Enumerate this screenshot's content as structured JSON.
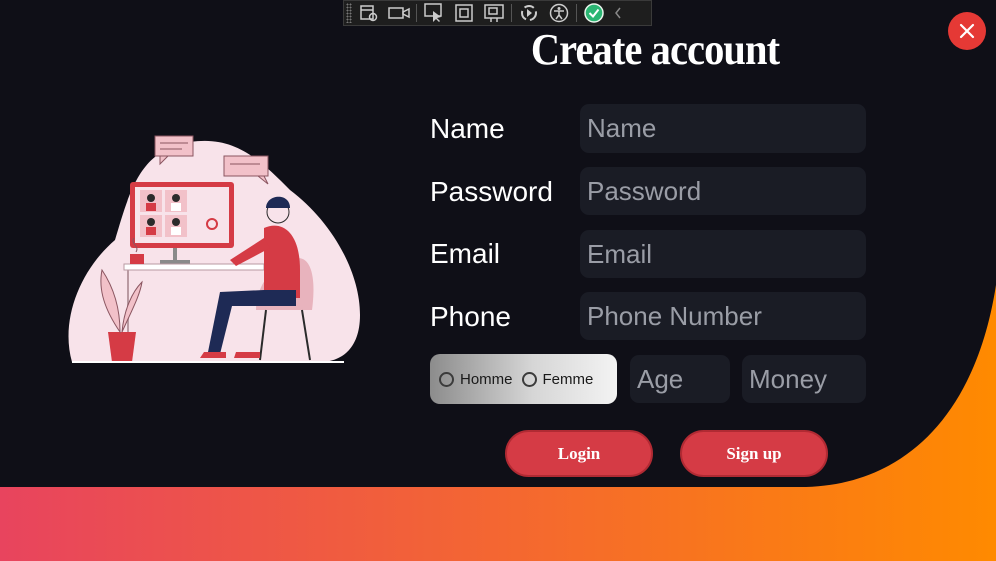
{
  "colors": {
    "background": "#0f0f17",
    "accent": "#d53b45",
    "wave_start": "#e8445e",
    "wave_end": "#ff8a00",
    "close": "#e53935",
    "field_bg": "#1a1c25"
  },
  "toolbar": {
    "icons": [
      "live-visual-tree-icon",
      "record-icon",
      "select-element-icon",
      "display-layout-adorners-icon",
      "track-focus-icon",
      "hot-reload-icon",
      "accessibility-icon",
      "binding-check-icon",
      "collapse-icon"
    ]
  },
  "form": {
    "title": "Create account",
    "name_label": "Name",
    "name_placeholder": "Name",
    "password_label": "Password",
    "password_placeholder": "Password",
    "email_label": "Email",
    "email_placeholder": "Email",
    "phone_label": "Phone",
    "phone_placeholder": "Phone Number",
    "gender_options": [
      "Homme",
      "Femme"
    ],
    "age_placeholder": "Age",
    "money_placeholder": "Money",
    "login_label": "Login",
    "signup_label": "Sign up"
  },
  "illustration": {
    "name": "video-call-illustration"
  }
}
